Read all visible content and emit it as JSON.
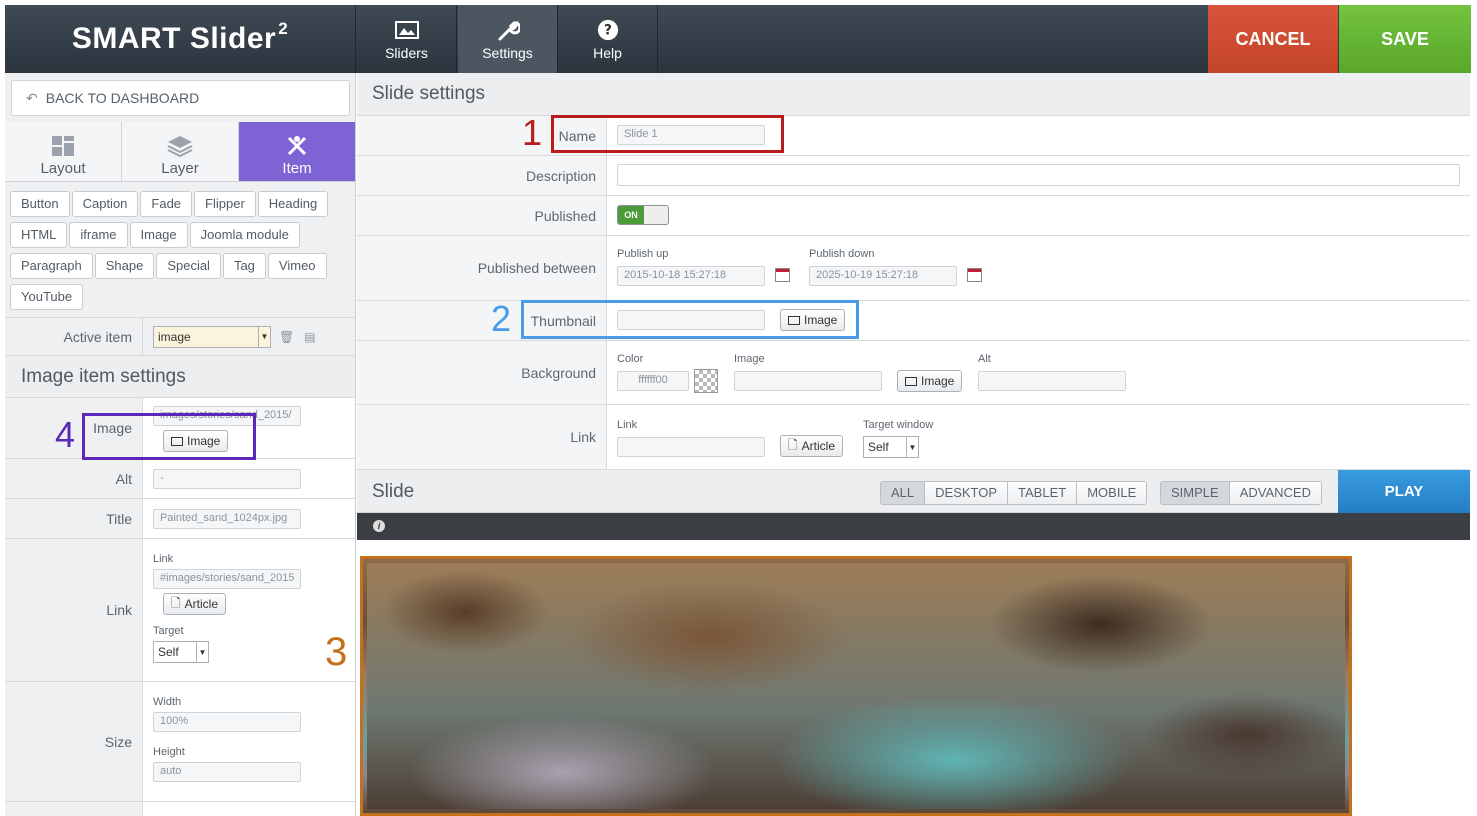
{
  "topbar": {
    "logo_text": "SMART Slider",
    "logo_sup": "2",
    "nav": [
      {
        "label": "Sliders",
        "icon": "image-icon"
      },
      {
        "label": "Settings",
        "icon": "wrench-icon"
      },
      {
        "label": "Help",
        "icon": "help-icon"
      }
    ],
    "cancel_label": "CANCEL",
    "save_label": "SAVE",
    "cancel_color": "#c8492f",
    "save_color": "#66b535"
  },
  "sidebar": {
    "back_label": "BACK TO DASHBOARD",
    "tabs": [
      {
        "label": "Layout",
        "icon": "layout-icon"
      },
      {
        "label": "Layer",
        "icon": "layers-icon"
      },
      {
        "label": "Item",
        "icon": "item-icon",
        "active": true
      }
    ],
    "item_types": [
      "Button",
      "Caption",
      "Fade",
      "Flipper",
      "Heading",
      "HTML",
      "iframe",
      "Image",
      "Joomla module",
      "Paragraph",
      "Shape",
      "Special",
      "Tag",
      "Vimeo",
      "YouTube"
    ],
    "active_item_label": "Active item",
    "active_item_value": "image",
    "item_settings_title": "Image item settings",
    "image_label": "Image",
    "image_value": "images/stories/sand_2015/",
    "image_button": "Image",
    "alt_label": "Alt",
    "alt_value": "-",
    "title_label": "Title",
    "title_value": "Painted_sand_1024px.jpg",
    "link_label": "Link",
    "link_sub_label": "Link",
    "link_value": "#images/stories/sand_2015",
    "article_button": "Article",
    "target_label": "Target",
    "target_value": "Self",
    "size_label": "Size",
    "width_label": "Width",
    "width_value": "100%",
    "height_label": "Height",
    "height_value": "auto"
  },
  "main": {
    "slide_settings_title": "Slide settings",
    "name_label": "Name",
    "name_value": "Slide 1",
    "description_label": "Description",
    "published_label": "Published",
    "published_toggle": "ON",
    "published_between_label": "Published between",
    "publish_up_label": "Publish up",
    "publish_up_value": "2015-10-18 15:27:18",
    "publish_down_label": "Publish down",
    "publish_down_value": "2025-10-19 15:27:18",
    "thumbnail_label": "Thumbnail",
    "thumbnail_button": "Image",
    "background_label": "Background",
    "color_label": "Color",
    "color_value": "ffffff00",
    "bg_image_label": "Image",
    "bg_image_button": "Image",
    "bg_alt_label": "Alt",
    "link_row_label": "Link",
    "link_sub_label": "Link",
    "article_button": "Article",
    "target_window_label": "Target window",
    "target_window_value": "Self",
    "slide_title": "Slide",
    "device_tabs": [
      "ALL",
      "DESKTOP",
      "TABLET",
      "MOBILE"
    ],
    "mode_tabs": [
      "SIMPLE",
      "ADVANCED"
    ],
    "play_label": "PLAY",
    "info_icon": "i"
  },
  "annotations": [
    {
      "number": "1",
      "color": "#b81c1c"
    },
    {
      "number": "2",
      "color": "#4a9be8"
    },
    {
      "number": "3",
      "color": "#c4701c"
    },
    {
      "number": "4",
      "color": "#5b28b8"
    }
  ]
}
